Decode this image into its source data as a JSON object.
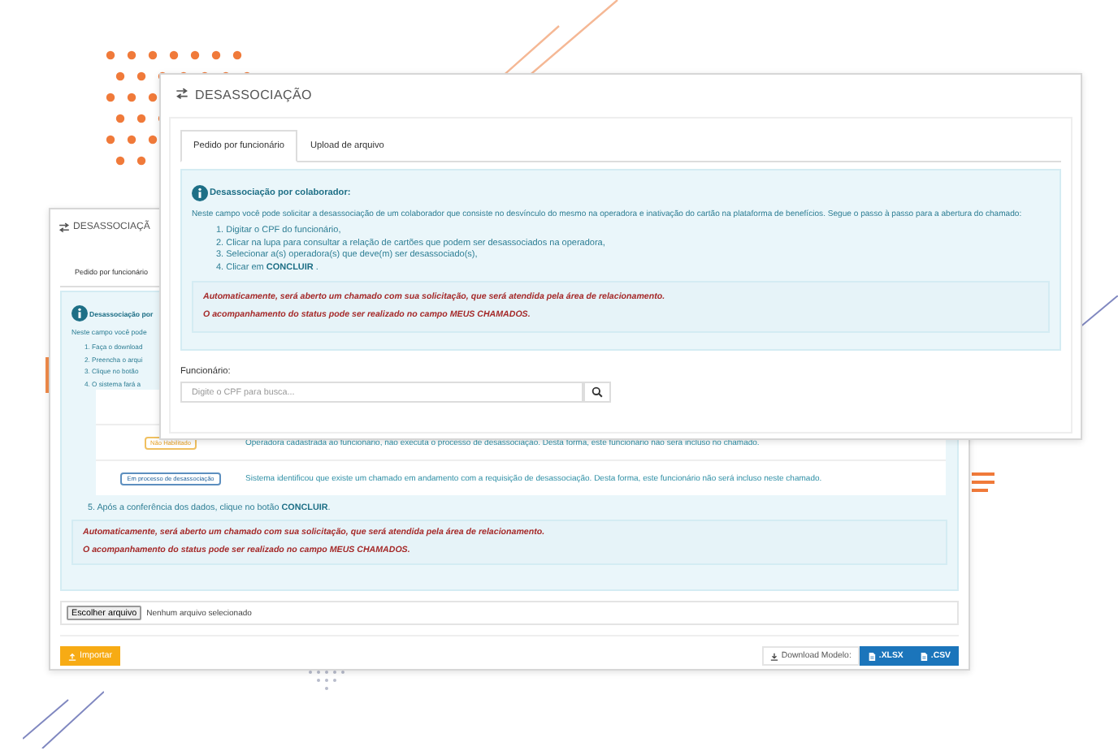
{
  "back_window": {
    "title": "DESASSOCIAÇÃ",
    "tabs": [
      {
        "label": "Pedido por funcionário",
        "selected": false
      }
    ],
    "info": {
      "heading": "Desassociação por",
      "intro": "Neste campo você pode",
      "steps": [
        "1. Faça o download",
        "2. Preencha o arqui",
        "3. Clique no botão",
        "4. O sistema fará a"
      ]
    },
    "status_rows": [
      {
        "badge": "Não Habilitado",
        "kind": "warning",
        "description": "Operadora cadastrada ao funcionário, não executa o processo de desassociação. Desta forma, este funcionário não será incluso no chamado."
      },
      {
        "badge": "Em processo de desassociação",
        "kind": "info",
        "description": "Sistema identificou que existe um chamado em andamento com a requisição de desassociação. Desta forma, este funcionário não será incluso neste chamado."
      }
    ],
    "final_step": "5. Após a conferência dos dados, clique no botão **CONCLUIR**.",
    "notes": [
      "Automaticamente, será aberto um chamado com sua solicitação, que será atendida pela área de relacionamento.",
      "O acompanhamento do status pode ser realizado no campo MEUS CHAMADOS."
    ],
    "file_input": {
      "button": "Escolher arquivo",
      "status": "Nenhum arquivo selecionado"
    },
    "import_button": "Importar",
    "download_label": "Download Modelo:",
    "download_buttons": [
      ".XLSX",
      ".CSV"
    ]
  },
  "front_window": {
    "title": "DESASSOCIAÇÃO",
    "tabs": [
      {
        "label": "Pedido por funcionário",
        "selected": true
      },
      {
        "label": "Upload de arquivo",
        "selected": false
      }
    ],
    "info": {
      "heading": "Desassociação por colaborador:",
      "intro": "Neste campo você pode solicitar a desassociação de um colaborador que consiste no desvínculo do mesmo na operadora e inativação do cartão na plataforma de benefícios. Segue o passo à passo para a abertura do chamado:",
      "steps": [
        "1. Digitar o CPF do funcionário,",
        "2. Clicar na lupa para consultar a relação de cartões que podem ser desassociados na operadora,",
        "3. Selecionar a(s) operadora(s) que deve(m) ser desassociado(s),",
        "4. Clicar em **CONCLUIR** ."
      ]
    },
    "notes": [
      "Automaticamente, será aberto um chamado com sua solicitação, que será atendida pela área de relacionamento.",
      "O acompanhamento do status pode ser realizado no campo MEUS CHAMADOS."
    ],
    "field": {
      "label": "Funcionário:",
      "placeholder": "Digite o CPF para busca..."
    }
  }
}
